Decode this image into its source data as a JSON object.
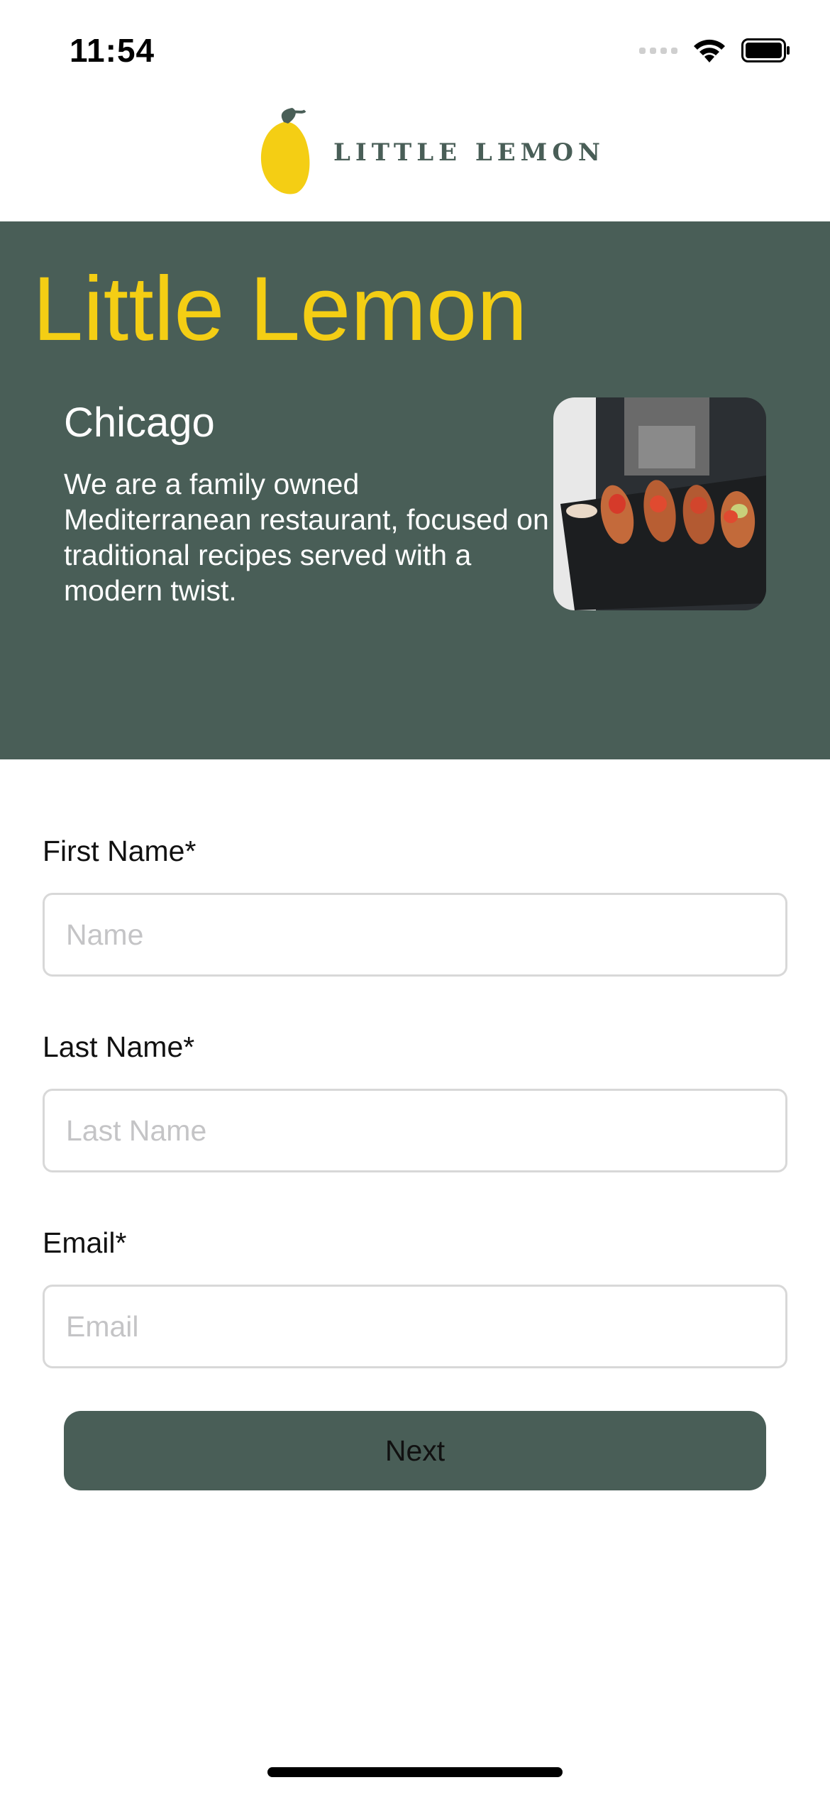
{
  "status_bar": {
    "time": "11:54",
    "icons": [
      "cellular-signal-icon",
      "wifi-icon",
      "battery-icon"
    ]
  },
  "header": {
    "logo_text": "LITTLE LEMON",
    "logo_icon": "lemon-icon"
  },
  "hero": {
    "title": "Little Lemon",
    "city": "Chicago",
    "description": "We are a family owned Mediterranean restaurant, focused on traditional recipes served with a modern twist.",
    "image": "food-platter-image"
  },
  "form": {
    "first_name": {
      "label": "First Name*",
      "placeholder": "Name",
      "value": ""
    },
    "last_name": {
      "label": "Last Name*",
      "placeholder": "Last Name",
      "value": ""
    },
    "email": {
      "label": "Email*",
      "placeholder": "Email",
      "value": ""
    },
    "next_label": "Next"
  },
  "colors": {
    "primary_green": "#495e57",
    "primary_yellow": "#f4ce14",
    "background": "#ffffff",
    "input_border": "#d8d8d8",
    "placeholder": "#c4c4c6"
  }
}
